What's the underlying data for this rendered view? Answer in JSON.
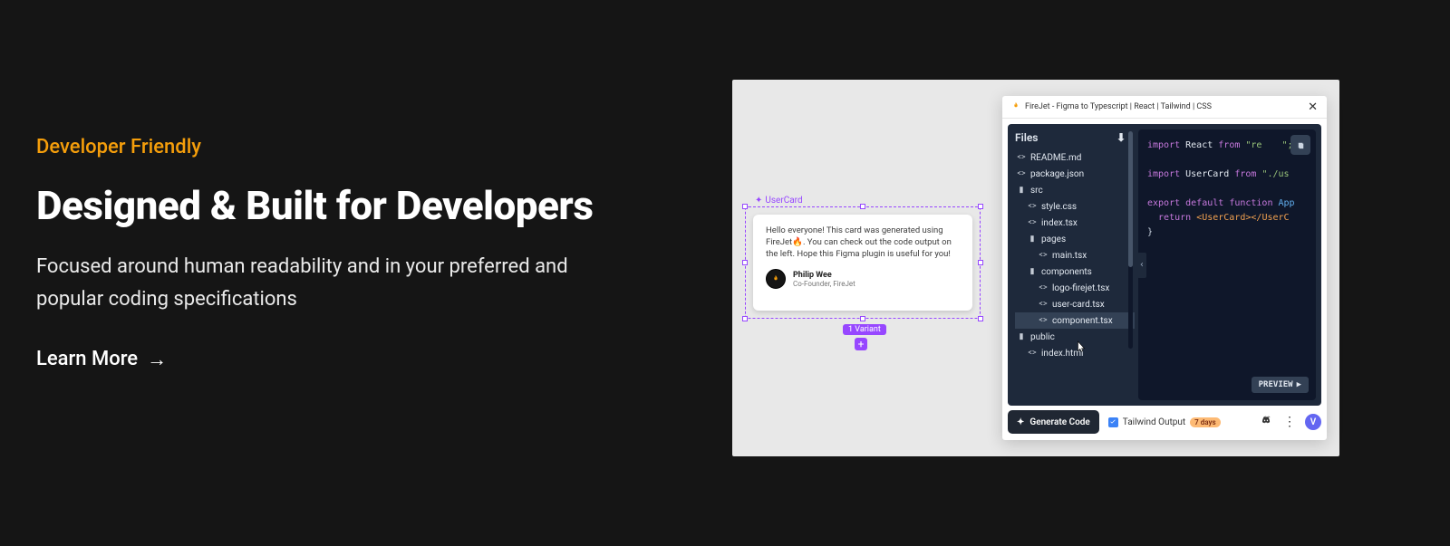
{
  "hero": {
    "eyebrow": "Developer Friendly",
    "headline": "Designed & Built for Developers",
    "sub": "Focused around human readability and in your preferred and popular coding specifications",
    "cta": "Learn More"
  },
  "figma": {
    "frame_label": "UserCard",
    "card_text": "Hello everyone! This card was generated using FireJet🔥. You can check out the code output on the left. Hope this Figma plugin is useful for you!",
    "author_name": "Philip Wee",
    "author_role": "Co-Founder, FireJet",
    "variant_badge": "1 Variant",
    "plus": "+"
  },
  "plugin": {
    "title": "FireJet - Figma to Typescript | React | Tailwind | CSS",
    "files_header": "Files",
    "tree": {
      "readme": "README.md",
      "package": "package.json",
      "src": "src",
      "style": "style.css",
      "indextsx": "index.tsx",
      "pages": "pages",
      "maintsx": "main.tsx",
      "components": "components",
      "logo": "logo-firejet.tsx",
      "usercard": "user-card.tsx",
      "component": "component.tsx",
      "public": "public",
      "indexhtml": "index.html"
    },
    "code": {
      "l1a": "import",
      "l1b": " React ",
      "l1c": "from",
      "l1d": " \"re",
      "l1e": "\";",
      "l2a": "import",
      "l2b": " UserCard ",
      "l2c": "from",
      "l2d": " \"./us",
      "l3a": "export",
      "l3b": " default ",
      "l3c": "function",
      "l3d": " App",
      "l4a": "  return ",
      "l4b": "<UserCard>",
      "l4c": "</UserC",
      "l5": "}"
    },
    "preview_btn": "PREVIEW",
    "generate_btn": "Generate Code",
    "tailwind_label": "Tailwind Output",
    "days_badge": "7 days",
    "avatar_letter": "V"
  }
}
